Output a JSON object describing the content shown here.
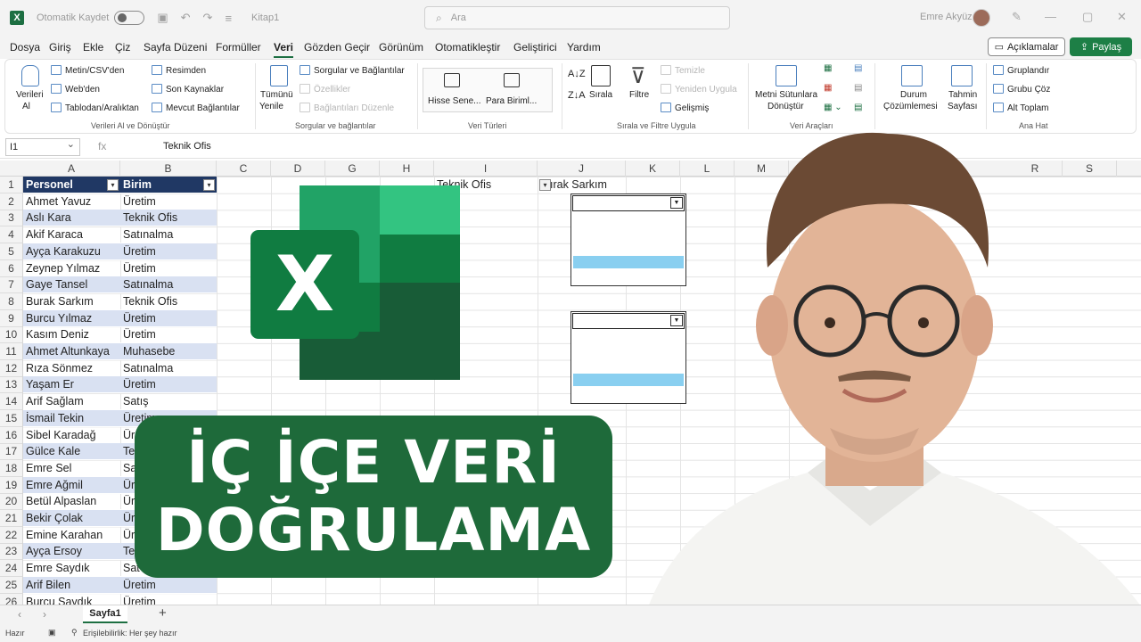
{
  "titlebar": {
    "autosave_label": "Otomatik Kaydet",
    "doc_title": "Kitap1",
    "search_placeholder": "Ara",
    "user_name": "Emre Akyüz"
  },
  "menu": {
    "tabs": [
      "Dosya",
      "Giriş",
      "Ekle",
      "Çiz",
      "Sayfa Düzeni",
      "Formüller",
      "Veri",
      "Gözden Geçir",
      "Görünüm",
      "Otomatikleştir",
      "Geliştirici",
      "Yardım"
    ],
    "active": "Veri",
    "comments_label": "Açıklamalar",
    "share_label": "Paylaş"
  },
  "ribbon": {
    "get_data_label_1": "Verileri",
    "get_data_label_2": "Al",
    "from_csv": "Metin/CSV'den",
    "from_web": "Web'den",
    "from_table": "Tablodan/Aralıktan",
    "from_picture": "Resimden",
    "recent_sources": "Son Kaynaklar",
    "existing_connections": "Mevcut Bağlantılar",
    "group_get": "Verileri Al ve Dönüştür",
    "refresh_all_1": "Tümünü",
    "refresh_all_2": "Yenile",
    "queries": "Sorgular ve Bağlantılar",
    "properties": "Özellikler",
    "edit_links": "Bağlantıları Düzenle",
    "group_queries": "Sorgular ve bağlantılar",
    "stocks": "Hisse Sene...",
    "currencies": "Para Biriml...",
    "group_types": "Veri Türleri",
    "sort": "Sırala",
    "filter": "Filtre",
    "clear": "Temizle",
    "reapply": "Yeniden Uygula",
    "advanced": "Gelişmiş",
    "group_sort": "Sırala ve Filtre Uygula",
    "text_to_columns_1": "Metni Sütunlara",
    "text_to_columns_2": "Dönüştür",
    "group_tools": "Veri Araçları",
    "what_if_1": "Durum",
    "what_if_2": "Çözümlemesi",
    "forecast_1": "Tahmin",
    "forecast_2": "Sayfası",
    "group": "Gruplandır",
    "ungroup": "Grubu Çöz",
    "subtotal": "Alt Toplam",
    "group_outline": "Ana Hat"
  },
  "formula_bar": {
    "name_box": "I1",
    "fx": "fx",
    "formula": "Teknik Ofis"
  },
  "columns": [
    "A",
    "B",
    "C",
    "D",
    "G",
    "H",
    "I",
    "J",
    "K",
    "L",
    "M",
    "R",
    "S"
  ],
  "rows": [
    "1",
    "2",
    "3",
    "4",
    "5",
    "6",
    "7",
    "8",
    "9",
    "10",
    "11",
    "12",
    "13",
    "14",
    "15",
    "16",
    "17",
    "18",
    "19",
    "20",
    "21",
    "22",
    "23",
    "24",
    "25",
    "26"
  ],
  "table": {
    "header": [
      "Personel",
      "Birim"
    ],
    "rows": [
      [
        "Ahmet Yavuz",
        "Üretim"
      ],
      [
        "Aslı Kara",
        "Teknik Ofis"
      ],
      [
        "Akif Karaca",
        "Satınalma"
      ],
      [
        "Ayça Karakuzu",
        "Üretim"
      ],
      [
        "Zeynep Yılmaz",
        "Üretim"
      ],
      [
        "Gaye Tansel",
        "Satınalma"
      ],
      [
        "Burak Sarkım",
        "Teknik Ofis"
      ],
      [
        "Burcu  Yılmaz",
        "Üretim"
      ],
      [
        "Kasım Deniz",
        "Üretim"
      ],
      [
        "Ahmet Altunkaya",
        "Muhasebe"
      ],
      [
        "Rıza Sönmez",
        "Satınalma"
      ],
      [
        "Yaşam  Er",
        "Üretim"
      ],
      [
        "Arif Sağlam",
        "Satış"
      ],
      [
        "İsmail  Tekin",
        "Üretim"
      ],
      [
        "Sibel Karadağ",
        "Üretim"
      ],
      [
        "Gülce Kale",
        "Teknik Ofis"
      ],
      [
        "Emre Sel",
        "Satınalma"
      ],
      [
        "Emre  Ağmil",
        "Üretim"
      ],
      [
        "Betül  Alpaslan",
        "Ür"
      ],
      [
        "Bekir  Çolak",
        "Ür"
      ],
      [
        "Emine  Karahan",
        "Ür"
      ],
      [
        "Ayça Ersoy",
        "Te"
      ],
      [
        "Emre  Saydık",
        "Sat"
      ],
      [
        "Arif Bilen",
        "Üretim"
      ],
      [
        "Burcu Saydık",
        "Üretim"
      ]
    ]
  },
  "selectors": {
    "i1_value": "Teknik Ofis",
    "j1_value": "ırak Sarkım"
  },
  "overlay": {
    "xl_letter": "X",
    "line1": "İÇ İÇE VERİ",
    "line2": "DOĞRULAMA"
  },
  "sheets": {
    "active": "Sayfa1",
    "add": "+"
  },
  "status": {
    "ready": "Hazır",
    "accessibility": "Erişilebilirlik: Her şey hazır"
  },
  "colors": {
    "excel_green": "#1d6f42",
    "table_header": "#203864",
    "band": "#d9e1f2",
    "list_highlight": "#89cff0",
    "banner": "#1e6a3a"
  }
}
